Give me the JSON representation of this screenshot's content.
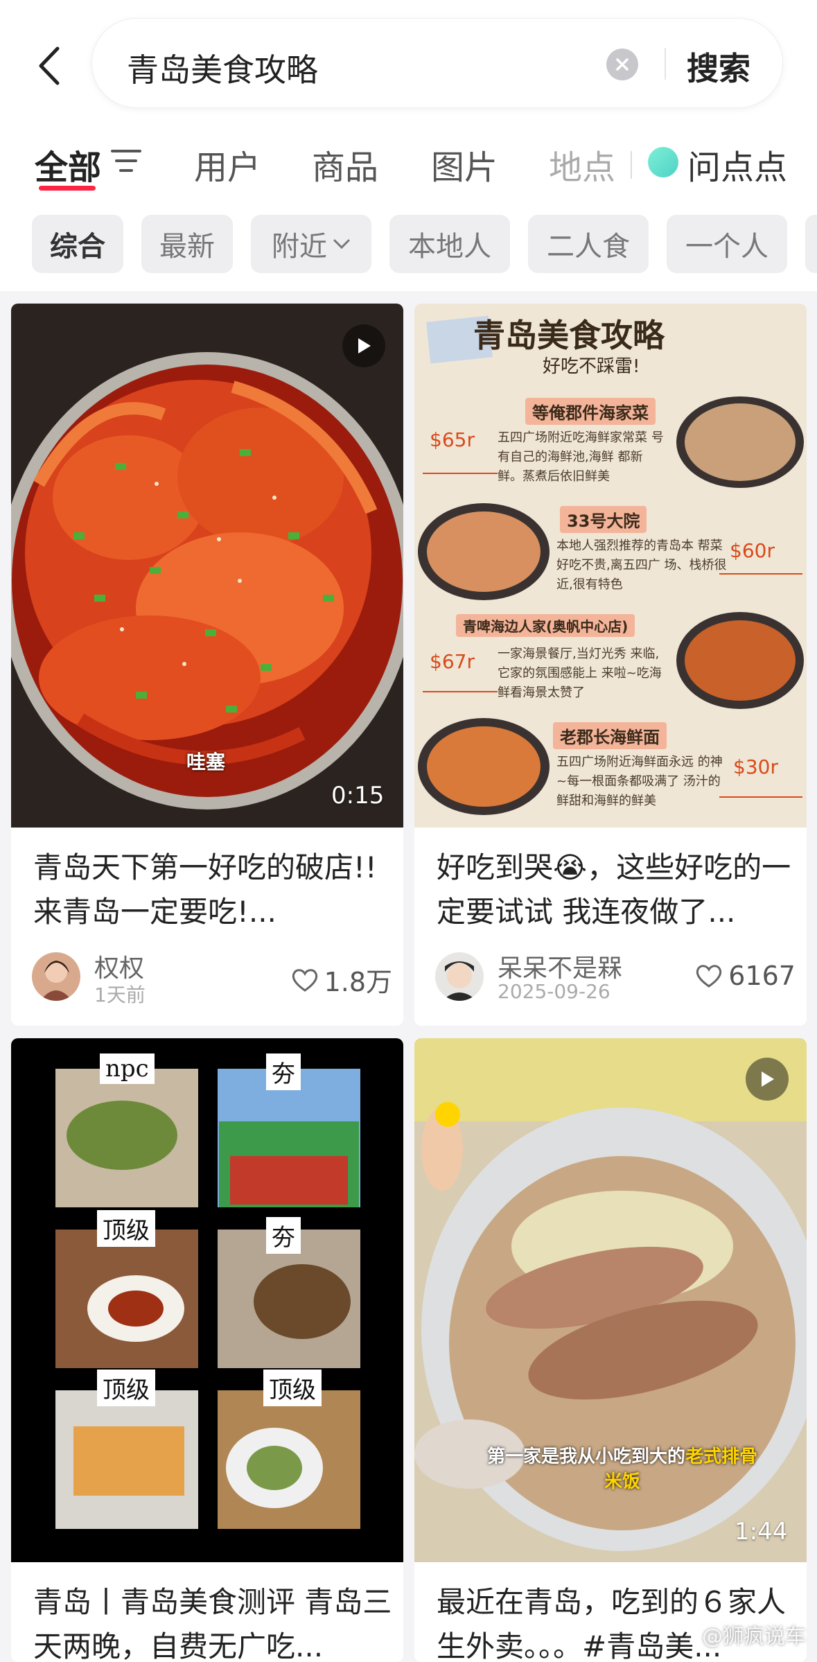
{
  "search": {
    "query": "青岛美食攻略",
    "button_label": "搜索"
  },
  "tabs": [
    {
      "label": "全部"
    },
    {
      "label": "用户"
    },
    {
      "label": "商品"
    },
    {
      "label": "图片"
    },
    {
      "label": "地点"
    },
    {
      "label": "问点点"
    }
  ],
  "chips": [
    {
      "label": "综合"
    },
    {
      "label": "最新"
    },
    {
      "label": "附近"
    },
    {
      "label": "本地人"
    },
    {
      "label": "二人食"
    },
    {
      "label": "一个人"
    }
  ],
  "posts": [
    {
      "title": "青岛天下第一好吃的破店!!来青岛一定要吃!...",
      "author": "权权",
      "time": "1天前",
      "likes": "1.8万",
      "duration": "0:15",
      "caption": "哇塞",
      "type": "video"
    },
    {
      "title": "好吃到哭😭，这些好吃的一定要试试 我连夜做了...",
      "author": "呆呆不是槑",
      "time": "2025-09-26",
      "likes": "6167",
      "type": "image",
      "poster": {
        "title": "青岛美食攻略",
        "subtitle": "好吃不踩雷!",
        "sections": [
          {
            "name": "等俺郡件海家菜",
            "price": "$65r",
            "text": "五四广场附近吃海鲜家常菜 号有自己的海鲜池,海鲜 都新鲜。蒸煮后依旧鲜美"
          },
          {
            "name": "33号大院",
            "price": "$60r",
            "text": "本地人强烈推荐的青岛本 帮菜好吃不贵,离五四广 场、栈桥很近,很有特色"
          },
          {
            "name": "青啤海边人家(奥帆中心店)",
            "price": "$67r",
            "text": "一家海景餐厅,当灯光秀 来临,它家的氛围感能上 来啦~吃海鲜看海景太赞了"
          },
          {
            "name": "老郡长海鲜面",
            "price": "$30r",
            "text": "五四广场附近海鲜面永远 的神~每一根面条都吸满了 汤汁的鲜甜和海鲜的鲜美"
          }
        ]
      }
    },
    {
      "title": "青岛丨青岛美食测评 青岛三天两晚，自费无广吃...",
      "type": "image",
      "grid_labels": [
        "npc",
        "夯",
        "顶级",
        "夯",
        "顶级",
        "顶级"
      ]
    },
    {
      "title": "最近在青岛，吃到的６家人生外卖。。。#青岛美...",
      "type": "video",
      "duration": "1:44",
      "caption_a": "第一家是我从小吃到大的",
      "caption_b": "老式排骨",
      "caption_c": "米饭"
    }
  ],
  "watermark": "@狮疯说车",
  "colors": {
    "accent": "#ff2442",
    "chip_bg": "#eeeef1",
    "page_bg": "#f4f4f6"
  }
}
